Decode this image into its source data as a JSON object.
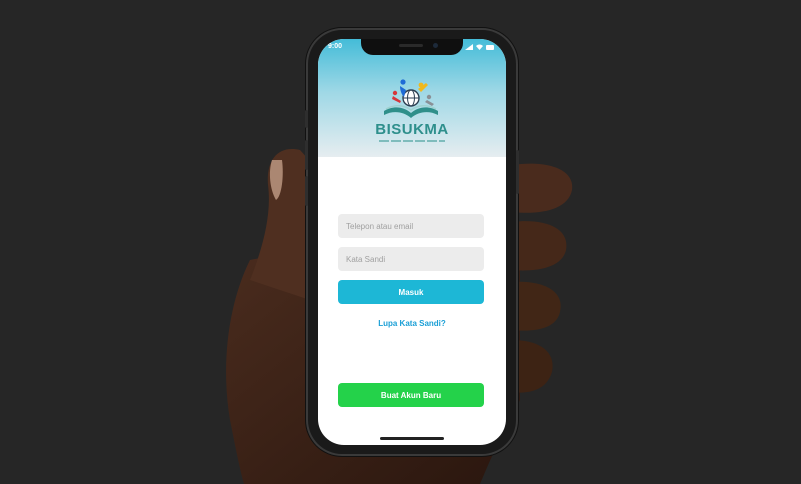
{
  "status_bar": {
    "time": "9:00"
  },
  "brand": {
    "name": "BISUKMA"
  },
  "login_form": {
    "identifier_placeholder": "Telepon atau email",
    "password_placeholder": "Kata Sandi",
    "login_label": "Masuk",
    "forgot_label": "Lupa Kata Sandi?"
  },
  "register": {
    "label": "Buat Akun Baru"
  },
  "colors": {
    "header_top": "#44bcd8",
    "login_button": "#1db7d6",
    "register_button": "#24d24a",
    "link": "#1a9fd6",
    "brand_text": "#2e8f8c"
  }
}
